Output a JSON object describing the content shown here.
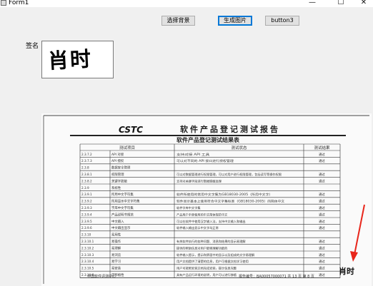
{
  "window": {
    "title": "Form1",
    "minimize_glyph": "—",
    "maximize_glyph": "☐",
    "close_glyph": "✕"
  },
  "toolbar": {
    "choose_bg_label": "选择背景",
    "generate_label": "生成图片",
    "button3_label": "button3"
  },
  "signature": {
    "label": "签名",
    "text": "肖时"
  },
  "document": {
    "brand": "CSTC",
    "heading": "软件产品登记测试报告",
    "table_title": "软件产品登记测试结果表",
    "columns": [
      "测试项目",
      "测试状态",
      "测试结果"
    ],
    "rows": [
      {
        "id": "2.3.7.2",
        "item": "API 对接",
        "status": "支持对接 API 工具",
        "result": "通过"
      },
      {
        "id": "2.3.7.3",
        "item": "API 授权",
        "status": "可以对不同的 API 接口进行授权管理",
        "result": "通过"
      },
      {
        "id": "2.3.8",
        "item": "数据安全管理",
        "status": "",
        "result": ""
      },
      {
        "id": "2.3.8.1",
        "item": "权限管理",
        "status": "可以对数据管理进行权限管理，可以对用户进行权限管理，包括读写等操作权限",
        "result": "通过"
      },
      {
        "id": "2.3.8.2",
        "item": "关键字脱敏",
        "status": "支持对关键字段进行数据脱敏处理",
        "result": "通过"
      },
      {
        "id": "2.3.9",
        "item": "系统性",
        "status": "",
        "result": ""
      },
      {
        "id": "2.3.9.1",
        "item": "所用中文字符集",
        "status": "软件所使用的常用中文字集为GB18030-2005（所用中文字）",
        "result": "通过"
      },
      {
        "id": "2.3.9.2",
        "item": "所用显示中文字符集",
        "status": "软件显示基本上使用符合中文字集标准（GB18030-2005）的简体中文",
        "result": "通过"
      },
      {
        "id": "2.3.9.3",
        "item": "字库中文字符集",
        "status": "软件字库中文字集",
        "result": "通过"
      },
      {
        "id": "2.3.9.4",
        "item": "产品说明书规范",
        "status": "产品用户手册使用的中文简体规范中文",
        "result": "通过"
      },
      {
        "id": "2.3.9.5",
        "item": "中文输入",
        "status": "可以在软件中使用汉字输入法，支持中文输入和输出",
        "result": "通过"
      },
      {
        "id": "2.3.9.6",
        "item": "中文输出显示",
        "status": "软件输入输出显示中文字均正常",
        "result": "通过"
      },
      {
        "id": "2.3.10",
        "item": "易用性",
        "status": "",
        "result": ""
      },
      {
        "id": "2.3.10.1",
        "item": "易操作",
        "status": "有关软件执行的各种问题、消息和结果的显示易理解",
        "result": "通过"
      },
      {
        "id": "2.3.10.2",
        "item": "易理解",
        "status": "提供的帮助信息对用户能够理解功能的",
        "result": "通过"
      },
      {
        "id": "2.3.10.3",
        "item": "易浏览",
        "status": "软件输入提示，提示和界面中的显示以及组成的文字易理解",
        "result": "通过"
      },
      {
        "id": "2.3.10.4",
        "item": "易学习",
        "status": "用户文档提供了清楚的信息，用户可根据文档学习使用",
        "result": "通过"
      },
      {
        "id": "2.3.10.5",
        "item": "易安装",
        "status": "用户可按照安装文档完成安装，提示信息完整",
        "result": "通过"
      },
      {
        "id": "2.3.10.6",
        "item": "可移植性",
        "status": "具有产品运行环境的说明，用户可以进行移植",
        "result": "通过"
      }
    ],
    "footer_left": "中国软件评测中心",
    "footer_right": "报告编号：BA00057000071  共 13 页  第 8 页",
    "stamp_text": "肖时"
  }
}
